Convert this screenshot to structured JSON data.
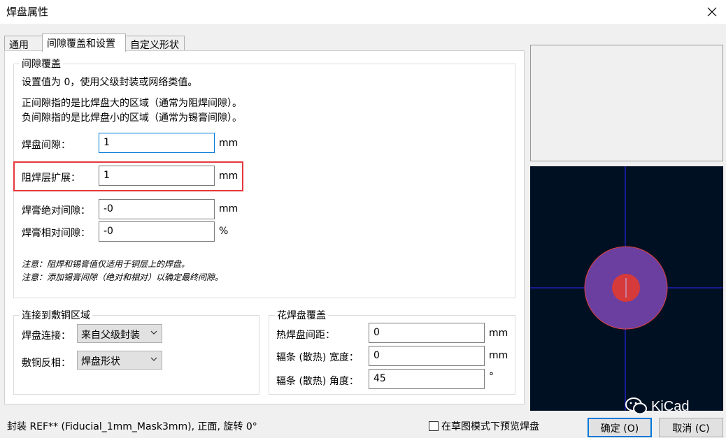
{
  "window": {
    "title": "焊盘属性",
    "close_glyph": "✕"
  },
  "tabs": [
    {
      "label": "通用"
    },
    {
      "label": "间隙覆盖和设置"
    },
    {
      "label": "自定义形状"
    }
  ],
  "clearance": {
    "group_title": "间隙覆盖",
    "info1": "设置值为 0，使用父级封装或网络类值。",
    "info2": "正间隙指的是比焊盘大的区域（通常为阻焊间隙）。",
    "info3": "负间隙指的是比焊盘小的区域（通常为锡膏间隙）。",
    "pad_clearance": {
      "label": "焊盘间隙：",
      "value": "1",
      "unit": "mm"
    },
    "mask_expansion": {
      "label": "阻焊层扩展：",
      "value": "1",
      "unit": "mm"
    },
    "paste_abs": {
      "label": "焊膏绝对间隙：",
      "value": "-0",
      "unit": "mm"
    },
    "paste_rel": {
      "label": "焊膏相对间隙：",
      "value": "-0",
      "unit": "%"
    },
    "note1": "注意：阻焊和锡膏值仅适用于铜层上的焊盘。",
    "note2": "注意：添加锡膏间隙（绝对和相对）以确定最终间隙。"
  },
  "connection": {
    "group_title": "连接到敷铜区域",
    "pad_conn": {
      "label": "焊盘连接：",
      "value": "来自父级封装"
    },
    "zone_invert": {
      "label": "敷铜反相：",
      "value": "焊盘形状"
    }
  },
  "thermal": {
    "group_title": "花焊盘覆盖",
    "gap": {
      "label": "热焊盘间距：",
      "value": "0",
      "unit": "mm"
    },
    "spoke_width": {
      "label": "辐条 (散热) 宽度：",
      "value": "0",
      "unit": "mm"
    },
    "spoke_angle": {
      "label": "辐条 (散热) 角度：",
      "value": "45",
      "unit": "°"
    }
  },
  "status_text": "封装 REF** (Fiducial_1mm_Mask3mm), 正面, 旋转 0°",
  "sketch_preview": {
    "label": "在草图模式下预览焊盘",
    "checked": false
  },
  "buttons": {
    "ok": "确定 (O)",
    "cancel": "取消 (C)"
  },
  "watermark": {
    "text": "KiCad"
  },
  "colors": {
    "preview_bg": "#001023",
    "pad_fill": "#d63a3a",
    "mask_fill": "#6a3fa0",
    "crosshair": "#2a2aff",
    "highlight": "#e4393c"
  }
}
